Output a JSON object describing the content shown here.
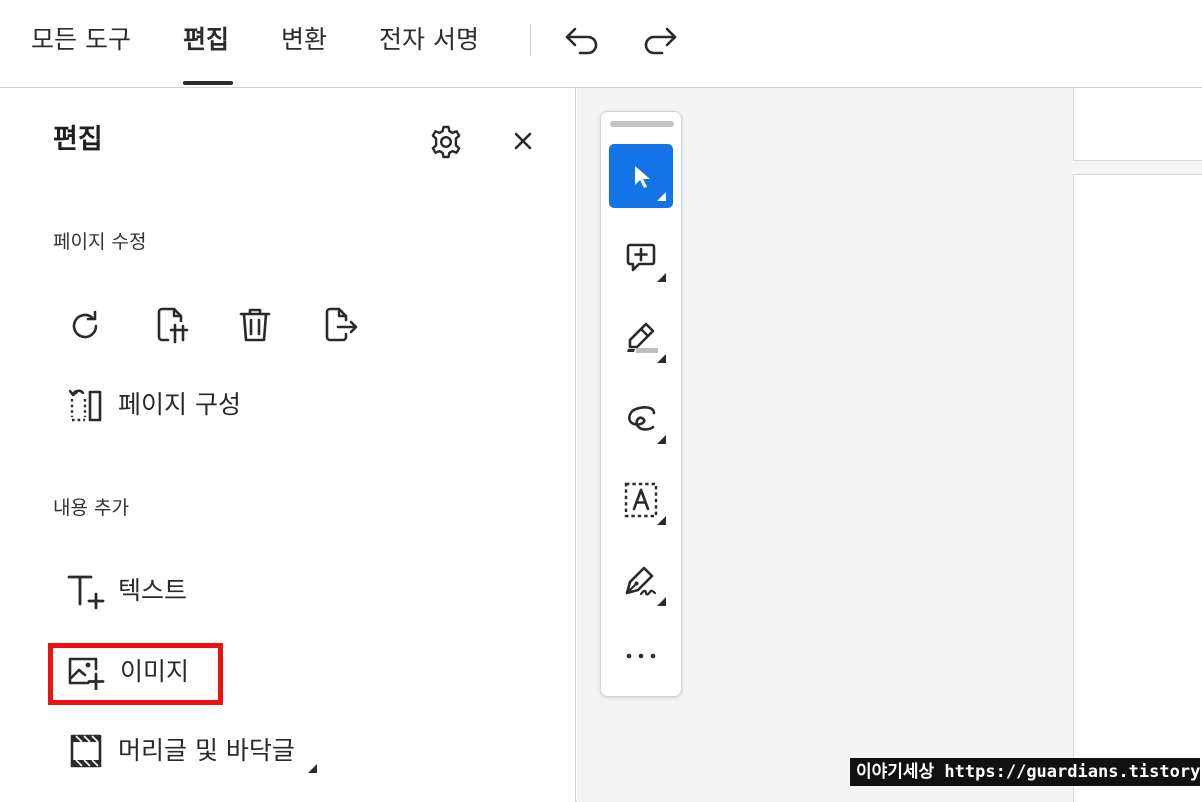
{
  "menubar": {
    "items": [
      {
        "label": "모든 도구"
      },
      {
        "label": "편집"
      },
      {
        "label": "변환"
      },
      {
        "label": "전자 서명"
      }
    ],
    "active_index": 1,
    "undo_icon": "undo-icon",
    "redo_icon": "redo-icon"
  },
  "panel": {
    "title": "편집",
    "settings_icon": "gear-icon",
    "close_icon": "close-icon",
    "page_edit": {
      "label": "페이지 수정",
      "tools": [
        "rotate-icon",
        "insert-page-icon",
        "trash-icon",
        "extract-page-icon"
      ],
      "organize_label": "페이지 구성"
    },
    "add_content": {
      "label": "내용 추가",
      "text_label": "텍스트",
      "image_label": "이미지",
      "header_footer_label": "머리글 및 바닥글"
    }
  },
  "toolbar": {
    "tools": [
      "select-cursor-icon",
      "add-comment-icon",
      "highlighter-icon",
      "freehand-draw-icon",
      "text-box-icon",
      "signature-pen-icon",
      "more-options-icon"
    ],
    "selected_index": 0
  },
  "colors": {
    "accent": "#1473e6",
    "highlight_border": "#ee1111"
  },
  "watermark": "이야기세상 https://guardians.tistory.com"
}
